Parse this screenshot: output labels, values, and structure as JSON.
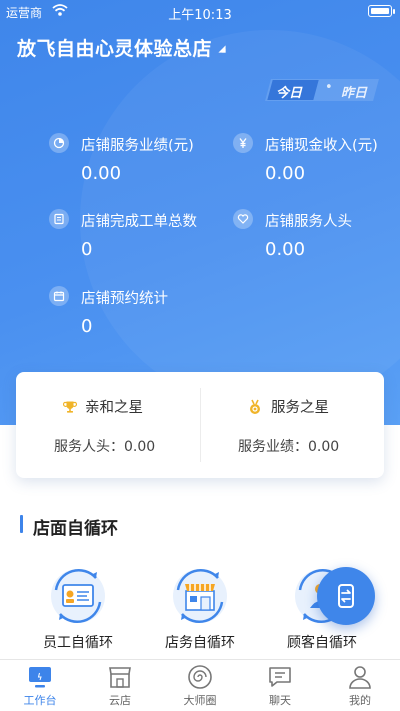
{
  "status_bar": {
    "carrier": "运营商",
    "time": "上午10:13"
  },
  "header": {
    "store_name": "放飞自由心灵体验总店"
  },
  "day_switch": {
    "today": "今日",
    "separator": "•",
    "yesterday": "昨日"
  },
  "metrics": [
    {
      "label": "店铺服务业绩(元)",
      "value": "0.00",
      "icon": "pie-chart-icon"
    },
    {
      "label": "店铺现金收入(元)",
      "value": "0.00",
      "icon": "yuan-icon"
    },
    {
      "label": "店铺完成工单总数",
      "value": "0",
      "icon": "order-list-icon"
    },
    {
      "label": "店铺服务人头",
      "value": "0.00",
      "icon": "heart-hand-icon"
    },
    {
      "label": "店铺预约统计",
      "value": "0",
      "icon": "calendar-icon"
    }
  ],
  "stars": [
    {
      "title": "亲和之星",
      "value_text": "服务人头：0.00",
      "icon": "trophy-icon"
    },
    {
      "title": "服务之星",
      "value_text": "服务业绩：0.00",
      "icon": "medal-icon"
    }
  ],
  "section": {
    "title": "店面自循环"
  },
  "loops": [
    {
      "label": "员工自循环",
      "icon": "employee-card-icon"
    },
    {
      "label": "店务自循环",
      "icon": "shop-front-icon"
    },
    {
      "label": "顾客自循环",
      "icon": "customer-icon"
    }
  ],
  "tabs": [
    {
      "label": "工作台",
      "icon": "monitor-icon",
      "active": true
    },
    {
      "label": "云店",
      "icon": "store-icon",
      "active": false
    },
    {
      "label": "大师圈",
      "icon": "spiral-icon",
      "active": false
    },
    {
      "label": "聊天",
      "icon": "chat-icon",
      "active": false
    },
    {
      "label": "我的",
      "icon": "user-icon",
      "active": false
    }
  ],
  "colors": {
    "primary": "#3f86ea",
    "active_tab": "#3d84ea",
    "gold": "#f0b429"
  }
}
